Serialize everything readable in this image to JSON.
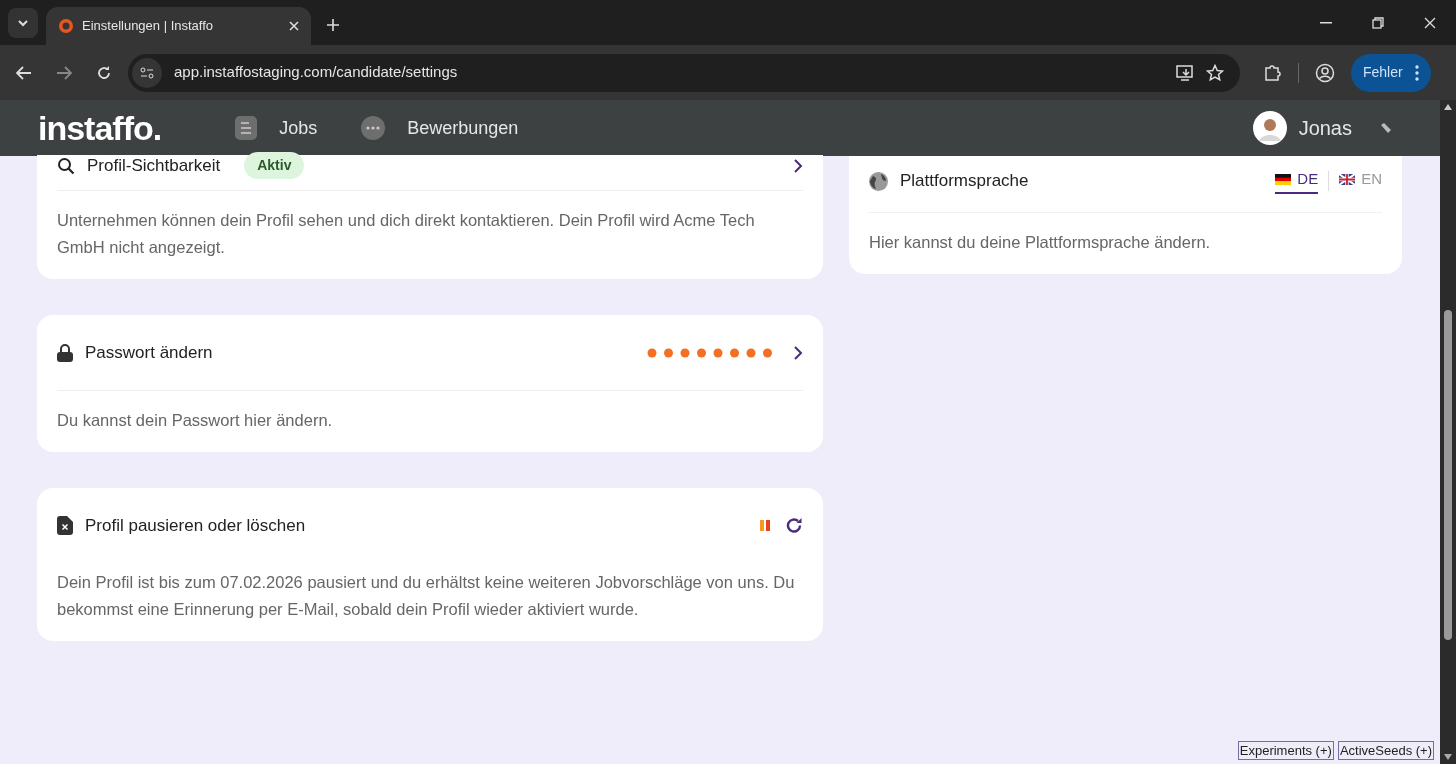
{
  "browser": {
    "tab_title": "Einstellungen | Instaffo",
    "url": "app.instaffostaging.com/candidate/settings",
    "profile_button": "Fehler"
  },
  "header": {
    "logo": "instaffo.",
    "nav": [
      {
        "label": "Jobs",
        "kind": "jobs"
      },
      {
        "label": "Bewerbungen",
        "kind": "chat"
      }
    ],
    "user": "Jonas"
  },
  "cards": [
    {
      "kind": "visibility",
      "title": "Profil-Sichtbarkeit",
      "badge": "Aktiv",
      "description": "Unternehmen können dein Profil sehen und dich direkt kontaktieren. Dein Profil wird Acme Tech GmbH nicht angezeigt."
    },
    {
      "kind": "password",
      "title": "Passwort ändern",
      "description": "Du kannst dein Passwort hier ändern."
    },
    {
      "kind": "pause",
      "title": "Profil pausieren oder löschen",
      "description": "Dein Profil ist bis zum 07.02.2026 pausiert und du erhältst keine weiteren Jobvorschläge von uns. Du bekommst eine Erinnerung per E-Mail, sobald dein Profil wieder aktiviert wurde."
    }
  ],
  "language_card": {
    "title": "Plattformsprache",
    "languages": [
      {
        "code": "DE",
        "kind": "de",
        "selected": true
      },
      {
        "code": "EN",
        "kind": "en",
        "selected": false
      }
    ],
    "description": "Hier kannst du deine Plattformsprache ändern."
  },
  "debug_buttons": [
    "Experiments (+)",
    "ActiveSeeds (+)"
  ]
}
